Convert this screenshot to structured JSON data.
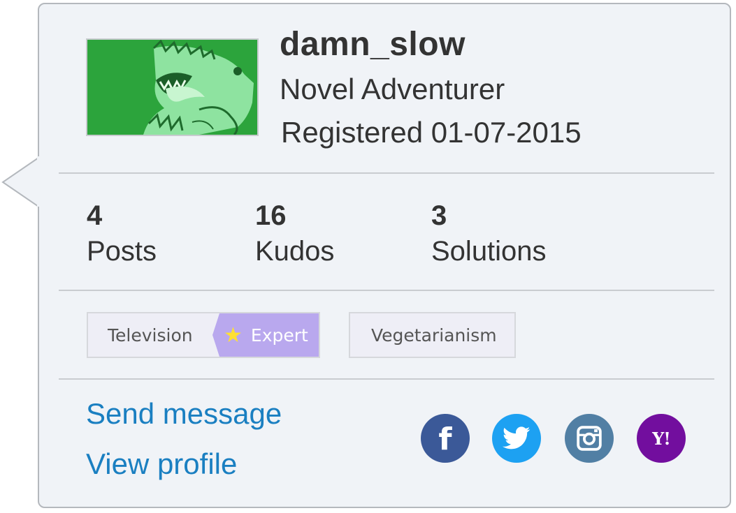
{
  "profile": {
    "username": "damn_slow",
    "rank": "Novel Adventurer",
    "registered": "Registered 01-07-2015"
  },
  "stats": [
    {
      "value": "4",
      "label": "Posts"
    },
    {
      "value": "16",
      "label": "Kudos"
    },
    {
      "value": "3",
      "label": "Solutions"
    }
  ],
  "badges": [
    {
      "label": "Television",
      "level": "Expert",
      "level_icon": "star-icon"
    },
    {
      "label": "Vegetarianism"
    }
  ],
  "actions": {
    "send_message": "Send message",
    "view_profile": "View profile"
  },
  "social": [
    {
      "icon": "facebook-icon",
      "glyph": "f",
      "color": "#3b5998"
    },
    {
      "icon": "twitter-icon",
      "color": "#1da1f2"
    },
    {
      "icon": "instagram-icon",
      "color": "#517fa4"
    },
    {
      "icon": "yahoo-icon",
      "glyph": "Y!",
      "color": "#720e9e"
    }
  ],
  "colors": {
    "card_background": "#f0f3f7",
    "link": "#1a7fc1",
    "expert_badge": "#b9a8ee",
    "avatar_green": "#2ca43c"
  }
}
